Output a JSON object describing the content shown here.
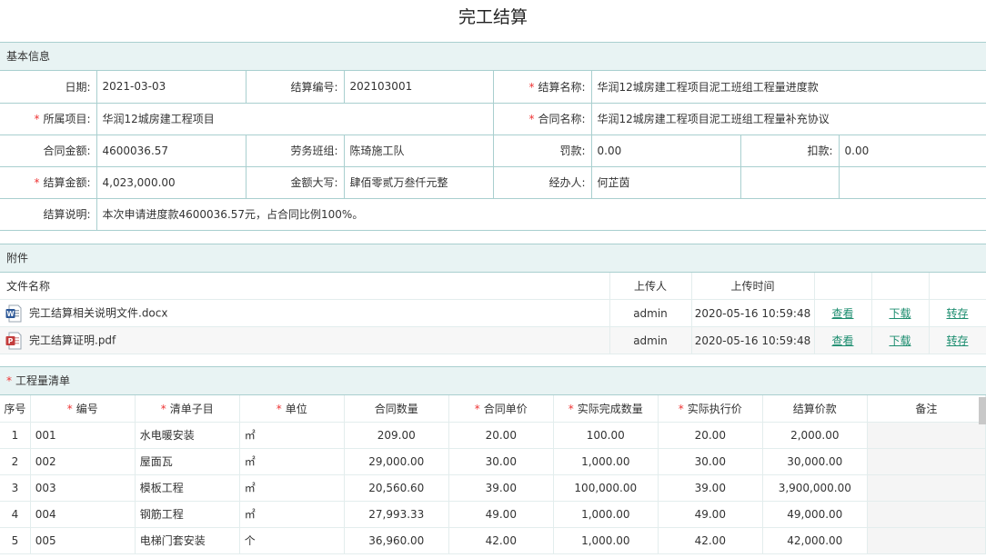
{
  "title": "完工结算",
  "basic_info": {
    "header": "基本信息",
    "date_label": "日期:",
    "date_value": "2021-03-03",
    "settle_no_label": "结算编号:",
    "settle_no_value": "202103001",
    "settle_name_label": "结算名称:",
    "settle_name_value": "华润12城房建工程项目泥工班组工程量进度款",
    "project_label": "所属项目:",
    "project_value": "华润12城房建工程项目",
    "contract_name_label": "合同名称:",
    "contract_name_value": "华润12城房建工程项目泥工班组工程量补充协议",
    "contract_amount_label": "合同金额:",
    "contract_amount_value": "4600036.57",
    "team_label": "劳务班组:",
    "team_value": "陈琦施工队",
    "penalty_label": "罚款:",
    "penalty_value": "0.00",
    "deduction_label": "扣款:",
    "deduction_value": "0.00",
    "settle_amount_label": "结算金额:",
    "settle_amount_value": "4,023,000.00",
    "amount_upper_label": "金额大写:",
    "amount_upper_value": "肆佰零贰万叁仟元整",
    "handler_label": "经办人:",
    "handler_value": "何芷茵",
    "desc_label": "结算说明:",
    "desc_value": "本次申请进度款4600036.57元，占合同比例100%。"
  },
  "attachments": {
    "header": "附件",
    "col_file": "文件名称",
    "col_uploader": "上传人",
    "col_time": "上传时间",
    "view_label": "查看",
    "download_label": "下载",
    "transfer_label": "转存",
    "files": [
      {
        "name": "完工结算相关说明文件.docx",
        "type": "word",
        "uploader": "admin",
        "time": "2020-05-16 10:59:48"
      },
      {
        "name": "完工结算证明.pdf",
        "type": "pdf",
        "uploader": "admin",
        "time": "2020-05-16 10:59:48"
      }
    ]
  },
  "quantities": {
    "header": "工程量清单",
    "cols": {
      "seq": "序号",
      "code": "编号",
      "item": "清单子目",
      "unit": "单位",
      "contract_qty": "合同数量",
      "contract_price": "合同单价",
      "actual_qty": "实际完成数量",
      "actual_price": "实际执行价",
      "settle_price": "结算价款",
      "note": "备注"
    },
    "rows": [
      {
        "seq": "1",
        "code": "001",
        "item": "水电暖安装",
        "unit": "㎡",
        "contract_qty": "209.00",
        "contract_price": "20.00",
        "actual_qty": "100.00",
        "actual_price": "20.00",
        "settle_price": "2,000.00",
        "note": ""
      },
      {
        "seq": "2",
        "code": "002",
        "item": "屋面瓦",
        "unit": "㎡",
        "contract_qty": "29,000.00",
        "contract_price": "30.00",
        "actual_qty": "1,000.00",
        "actual_price": "30.00",
        "settle_price": "30,000.00",
        "note": ""
      },
      {
        "seq": "3",
        "code": "003",
        "item": "模板工程",
        "unit": "㎡",
        "contract_qty": "20,560.60",
        "contract_price": "39.00",
        "actual_qty": "100,000.00",
        "actual_price": "39.00",
        "settle_price": "3,900,000.00",
        "note": ""
      },
      {
        "seq": "4",
        "code": "004",
        "item": "钢筋工程",
        "unit": "㎡",
        "contract_qty": "27,993.33",
        "contract_price": "49.00",
        "actual_qty": "1,000.00",
        "actual_price": "49.00",
        "settle_price": "49,000.00",
        "note": ""
      },
      {
        "seq": "5",
        "code": "005",
        "item": "电梯门套安装",
        "unit": "个",
        "contract_qty": "36,960.00",
        "contract_price": "42.00",
        "actual_qty": "1,000.00",
        "actual_price": "42.00",
        "settle_price": "42,000.00",
        "note": ""
      }
    ]
  },
  "colors": {
    "border": "#a9cfcf",
    "header_bg": "#e8f3f3",
    "link": "#1c8d6f",
    "required": "#e33333"
  }
}
